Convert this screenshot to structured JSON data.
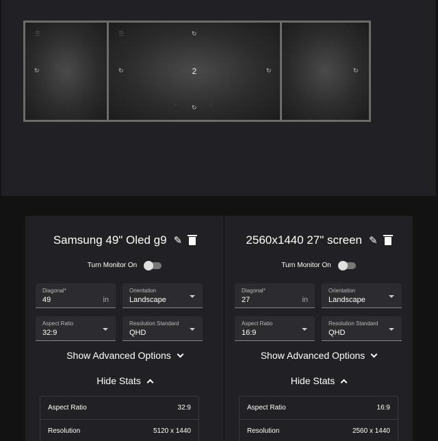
{
  "arrangement": {
    "screens": [
      {
        "number": ""
      },
      {
        "number": "2"
      },
      {
        "number": ""
      }
    ],
    "icons": {
      "rotate": "rotate-icon",
      "menu": "menu-icon",
      "swap": "swap-icon"
    }
  },
  "cards": [
    {
      "title": "Samsung 49\" Oled g9",
      "toggle_label": "Turn Monitor On",
      "diagonal": {
        "label": "Diagonal*",
        "value": "49",
        "unit": "in"
      },
      "orientation": {
        "label": "Orientation",
        "value": "Landscape"
      },
      "aspect_ratio": {
        "label": "Aspect Ratio",
        "value": "32:9"
      },
      "resolution_standard": {
        "label": "Resolution Standard",
        "value": "QHD"
      },
      "advanced_label": "Show Advanced Options",
      "stats_label": "Hide Stats",
      "stats": [
        {
          "label": "Aspect Ratio",
          "value": "32:9"
        },
        {
          "label": "Resolution",
          "value": "5120 x 1440"
        }
      ]
    },
    {
      "title": "2560x1440 27\" screen",
      "toggle_label": "Turn Monitor On",
      "diagonal": {
        "label": "Diagonal*",
        "value": "27",
        "unit": "in"
      },
      "orientation": {
        "label": "Orientation",
        "value": "Landscape"
      },
      "aspect_ratio": {
        "label": "Aspect Ratio",
        "value": "16:9"
      },
      "resolution_standard": {
        "label": "Resolution Standard",
        "value": "QHD"
      },
      "advanced_label": "Show Advanced Options",
      "stats_label": "Hide Stats",
      "stats": [
        {
          "label": "Aspect Ratio",
          "value": "16:9"
        },
        {
          "label": "Resolution",
          "value": "2560 x 1440"
        }
      ]
    }
  ]
}
